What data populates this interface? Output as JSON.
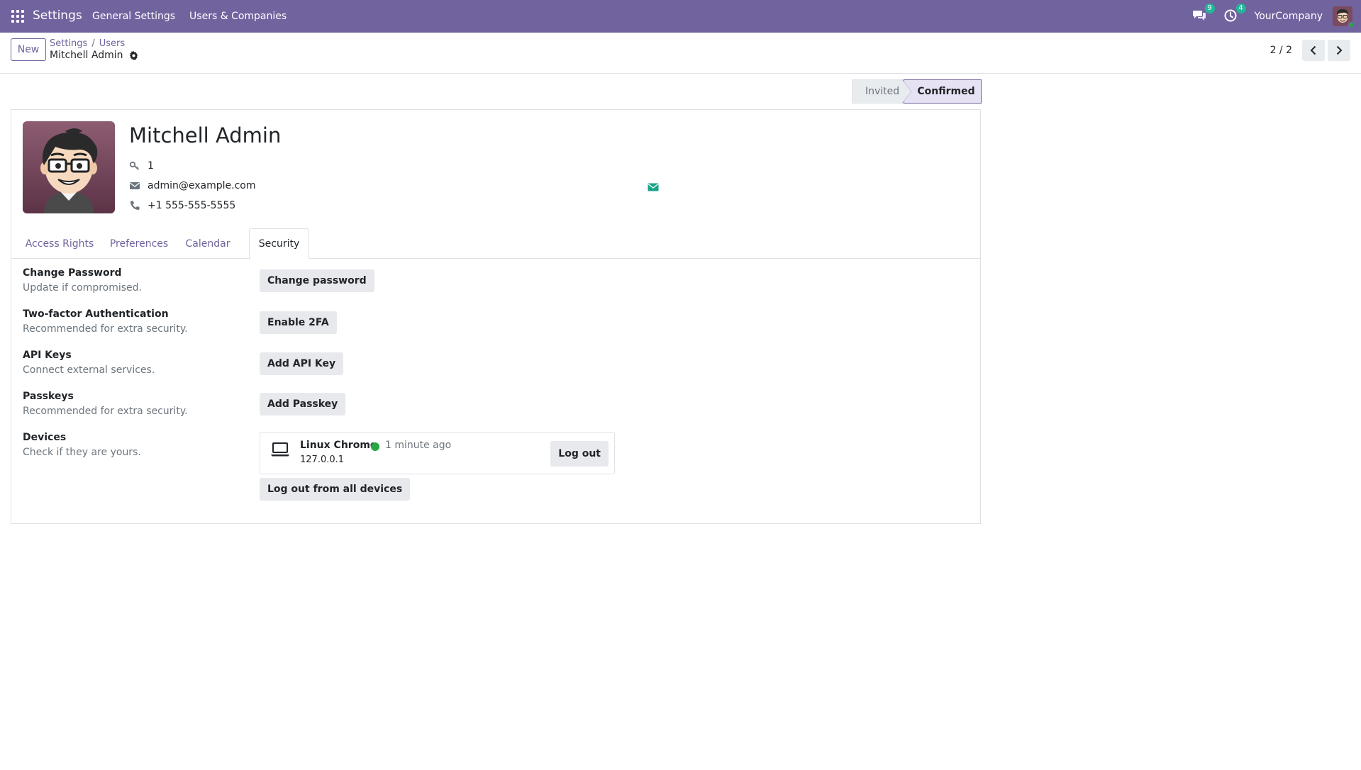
{
  "navbar": {
    "app_name": "Settings",
    "menu": [
      "General Settings",
      "Users & Companies"
    ],
    "messages_badge": "9",
    "activities_badge": "4",
    "company": "YourCompany",
    "bg_color": "#71639e"
  },
  "control_panel": {
    "new_label": "New",
    "breadcrumb": [
      "Settings",
      "Users"
    ],
    "breadcrumb_sep": "/",
    "current_record": "Mitchell Admin",
    "pager": "2 / 2"
  },
  "status": {
    "invited": "Invited",
    "confirmed": "Confirmed",
    "active": "Confirmed"
  },
  "user": {
    "name": "Mitchell Admin",
    "login_id": "1",
    "email": "admin@example.com",
    "phone": "+1 555-555-5555"
  },
  "tabs": [
    {
      "label": "Access Rights",
      "active": false
    },
    {
      "label": "Preferences",
      "active": false
    },
    {
      "label": "Calendar",
      "active": false
    },
    {
      "label": "Security",
      "active": true
    }
  ],
  "security": {
    "change_password": {
      "label": "Change Password",
      "desc": "Update if compromised.",
      "button": "Change password"
    },
    "two_factor": {
      "label": "Two-factor Authentication",
      "desc": "Recommended for extra security.",
      "button": "Enable 2FA"
    },
    "api_keys": {
      "label": "API Keys",
      "desc": "Connect external services.",
      "button": "Add API Key"
    },
    "passkeys": {
      "label": "Passkeys",
      "desc": "Recommended for extra security.",
      "button": "Add Passkey"
    },
    "devices": {
      "label": "Devices",
      "desc": "Check if they are yours.",
      "items": [
        {
          "name": "Linux Chrome",
          "last_seen": "1 minute ago",
          "ip": "127.0.0.1",
          "logout_label": "Log out",
          "online": true
        }
      ],
      "logout_all": "Log out from all devices"
    }
  },
  "colors": {
    "accent": "#71639e",
    "online": "#28a745",
    "badge": "#21b799"
  }
}
